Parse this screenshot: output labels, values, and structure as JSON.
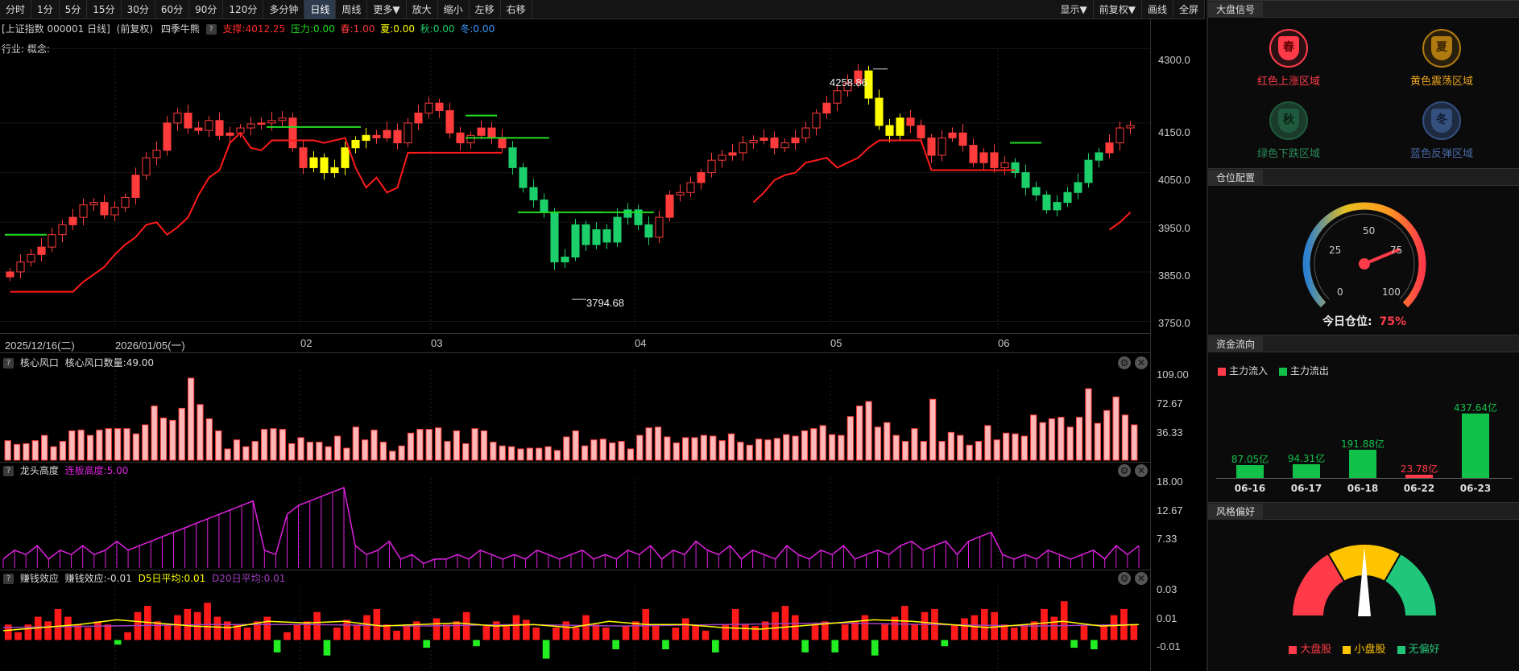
{
  "toolbar": {
    "periods": [
      "分时",
      "1分",
      "5分",
      "15分",
      "30分",
      "60分",
      "90分",
      "120分",
      "多分钟",
      "日线",
      "周线",
      "更多▼",
      "放大",
      "缩小",
      "左移",
      "右移"
    ],
    "active": "日线",
    "right_buttons": [
      "显示▼",
      "前复权▼",
      "画线",
      "全屏"
    ]
  },
  "info": {
    "security": "[上证指数 000001 日线]",
    "adjust": "(前复权)",
    "indicator": "四季牛熊",
    "support": "支撑:4012.25",
    "pressure": "压力:0.00",
    "spring": "春:1.00",
    "summer": "夏:0.00",
    "autumn": "秋:0.00",
    "winter": "冬:0.00",
    "industry": "行业: 概念:"
  },
  "colors": {
    "up": "#ff3b3b",
    "down": "#1ccf6a",
    "summer": "#ffff00",
    "support_line": "#ff1a1a",
    "pressure_line": "#22dd22",
    "magenta": "#e020e0",
    "purple": "#a040c0"
  },
  "main_chart": {
    "y_ticks": [
      "4300.0",
      "4150.0",
      "4050.0",
      "3950.0",
      "3850.0",
      "3750.0"
    ],
    "high_label": "4258.86",
    "low_label": "3794.68",
    "dates": [
      "2025/12/16(二)",
      "2026/01/05(一)",
      "02",
      "03",
      "04",
      "05",
      "06"
    ]
  },
  "sub1": {
    "title": "核心风口",
    "value_label": "核心风口数量:49.00",
    "y_ticks": [
      "109.00",
      "72.67",
      "36.33"
    ]
  },
  "sub2": {
    "title": "龙头高度",
    "value_label": "连板高度:5.00",
    "y_ticks": [
      "18.00",
      "12.67",
      "7.33"
    ]
  },
  "sub3": {
    "title": "赚钱效应",
    "value_label": "赚钱效应:-0.01",
    "d5": "D5日平均:0.01",
    "d20": "D20日平均:0.01",
    "y_ticks": [
      "0.03",
      "0.01",
      "-0.01"
    ]
  },
  "right": {
    "signal_title": "大盘信号",
    "seasons": [
      {
        "char": "春",
        "label": "红色上涨区域",
        "color": "#ff3b4a"
      },
      {
        "char": "夏",
        "label": "黄色震荡区域",
        "color": "#e8a21a"
      },
      {
        "char": "秋",
        "label": "绿色下跌区域",
        "color": "#2a8a5a"
      },
      {
        "char": "冬",
        "label": "蓝色反弹区域",
        "color": "#4a6aa8"
      }
    ],
    "position_title": "仓位配置",
    "gauge_ticks": [
      "0",
      "25",
      "50",
      "75",
      "100"
    ],
    "position_label": "今日仓位:",
    "position_value": "75%",
    "position_fraction": 0.75,
    "flow_title": "资金流向",
    "flow_in": "主力流入",
    "flow_out": "主力流出",
    "flows": [
      {
        "date": "06-16",
        "value": "87.05亿",
        "amount": 87.05,
        "dir": "out"
      },
      {
        "date": "06-17",
        "value": "94.31亿",
        "amount": 94.31,
        "dir": "out"
      },
      {
        "date": "06-18",
        "value": "191.88亿",
        "amount": 191.88,
        "dir": "out"
      },
      {
        "date": "06-22",
        "value": "23.78亿",
        "amount": 23.78,
        "dir": "in"
      },
      {
        "date": "06-23",
        "value": "437.64亿",
        "amount": 437.64,
        "dir": "out"
      }
    ],
    "style_title": "风格偏好",
    "style_legend": [
      "大盘股",
      "小盘股",
      "无偏好"
    ]
  },
  "chart_data": [
    {
      "type": "candlestick",
      "title": "上证指数 000001 日线",
      "ylim": [
        3730,
        4320
      ],
      "y_ticks": [
        4300,
        4150,
        4050,
        3950,
        3850,
        3750
      ],
      "high": 4258.86,
      "low": 3794.68,
      "close_path": [
        3850,
        3870,
        3885,
        3900,
        3925,
        3945,
        3960,
        3985,
        3990,
        3965,
        3980,
        4000,
        4045,
        4080,
        4095,
        4150,
        4170,
        4140,
        4135,
        4155,
        4125,
        4130,
        4140,
        4148,
        4150,
        4155,
        4160,
        4100,
        4060,
        4080,
        4050,
        4060,
        4100,
        4115,
        4125,
        4120,
        4135,
        4110,
        4150,
        4170,
        4190,
        4175,
        4130,
        4110,
        4125,
        4140,
        4120,
        4100,
        4060,
        4020,
        3995,
        3970,
        3870,
        3880,
        3945,
        3905,
        3935,
        3910,
        3960,
        3975,
        3945,
        3920,
        3960,
        4005,
        4010,
        4030,
        4050,
        4075,
        4085,
        4090,
        4110,
        4115,
        4120,
        4100,
        4110,
        4120,
        4140,
        4170,
        4190,
        4215,
        4230,
        4255,
        4200,
        4145,
        4125,
        4160,
        4145,
        4120,
        4085,
        4120,
        4130,
        4105,
        4070,
        4090,
        4060,
        4070,
        4050,
        4020,
        4005,
        3975,
        3990,
        4010,
        4030,
        4075,
        4090,
        4110,
        4140,
        4145
      ],
      "support_line": "red stepped line, last value 4012.25",
      "pressure_line": "green segments"
    },
    {
      "type": "bar",
      "title": "核心风口",
      "ylim": [
        0,
        109
      ],
      "y_ticks": [
        109.0,
        72.67,
        36.33
      ],
      "values": [
        26,
        21,
        22,
        26,
        33,
        18,
        25,
        39,
        40,
        33,
        40,
        42,
        42,
        42,
        35,
        47,
        72,
        56,
        53,
        69,
        109,
        74,
        55,
        39,
        15,
        27,
        18,
        25,
        41,
        42,
        41,
        22,
        30,
        24,
        24,
        18,
        32,
        16,
        44,
        27,
        40,
        24,
        12,
        19,
        36,
        41,
        41,
        43,
        25,
        39,
        22,
        42,
        39,
        24,
        19,
        18,
        15,
        16,
        16,
        18,
        13,
        31,
        39,
        19,
        27,
        28,
        23,
        25,
        15,
        33,
        43,
        44,
        31,
        23,
        30,
        30,
        33,
        32,
        26,
        35,
        24,
        20,
        28,
        27,
        29,
        34,
        32,
        39,
        42,
        46,
        34,
        33,
        58,
        72,
        78,
        44,
        50,
        33,
        25,
        42,
        25,
        81,
        25,
        37,
        33,
        20,
        25,
        46,
        27,
        36,
        35,
        32,
        60,
        50,
        55,
        57,
        44,
        57,
        95,
        49,
        66,
        84,
        60,
        47
      ]
    },
    {
      "type": "line",
      "title": "龙头高度",
      "ylim": [
        0,
        18
      ],
      "y_ticks": [
        18.0,
        12.67,
        7.33
      ],
      "series": [
        {
          "name": "连板高度",
          "values": [
            2,
            4,
            3,
            5,
            2,
            4,
            3,
            5,
            3,
            4,
            6,
            4,
            5,
            6,
            7,
            8,
            9,
            10,
            11,
            12,
            13,
            14,
            15,
            4,
            3,
            12,
            14,
            15,
            16,
            17,
            18,
            5,
            3,
            4,
            6,
            2,
            3,
            1,
            2,
            2,
            3,
            2,
            4,
            3,
            2,
            3,
            2,
            4,
            3,
            2,
            3,
            4,
            2,
            3,
            2,
            4,
            3,
            5,
            2,
            4,
            3,
            6,
            4,
            3,
            5,
            2,
            4,
            3,
            2,
            5,
            3,
            2,
            4,
            3,
            5,
            2,
            3,
            4,
            3,
            5,
            6,
            4,
            5,
            6,
            3,
            6,
            7,
            8,
            3,
            2,
            3,
            2,
            4,
            3,
            2,
            3,
            4,
            2,
            5,
            3,
            5
          ]
        }
      ]
    },
    {
      "type": "bar",
      "title": "赚钱效应",
      "ylim": [
        -0.02,
        0.035
      ],
      "y_ticks": [
        0.03,
        0.01,
        -0.01
      ],
      "series": [
        {
          "name": "赚钱效应",
          "values": [
            0.01,
            0.005,
            0.01,
            0.015,
            0.012,
            0.02,
            0.015,
            0.01,
            0.008,
            0.012,
            0.01,
            -0.003,
            0.005,
            0.018,
            0.022,
            0.012,
            0.01,
            0.016,
            0.02,
            0.018,
            0.024,
            0.015,
            0.012,
            0.01,
            0.008,
            0.012,
            0.015,
            -0.008,
            0.005,
            0.01,
            0.012,
            0.018,
            -0.01,
            0.008,
            0.013,
            0.01,
            0.016,
            0.02,
            0.01,
            0.006,
            0.01,
            0.012,
            -0.005,
            0.014,
            0.01,
            0.012,
            0.018,
            -0.004,
            0.009,
            0.012,
            0.01,
            0.016,
            0.013,
            0.008,
            -0.012,
            0.008,
            0.012,
            0.008,
            0.016,
            0.01,
            0.008,
            -0.006,
            0.009,
            0.012,
            0.02,
            0.01,
            -0.006,
            0.008,
            0.014,
            0.01,
            0.006,
            -0.008,
            0.01,
            0.02,
            0.01,
            0.009,
            0.012,
            0.018,
            0.022,
            0.016,
            -0.008,
            0.01,
            0.012,
            -0.008,
            0.01,
            0.012,
            0.016,
            -0.01,
            0.01,
            0.015,
            0.022,
            0.01,
            0.018,
            0.02,
            -0.004,
            0.01,
            0.014,
            0.016,
            0.02,
            0.018,
            0.01,
            0.008,
            0.01,
            0.012,
            0.02,
            0.015,
            0.025,
            -0.005,
            0.01,
            -0.006,
            0.01,
            0.016,
            0.02,
            0.01
          ]
        },
        {
          "name": "D5日平均",
          "values": [
            0.006,
            0.008,
            0.01,
            0.013,
            0.011,
            0.009,
            0.008,
            0.012,
            0.011,
            0.012,
            0.009,
            0.01,
            0.011,
            0.009,
            0.01,
            0.008,
            0.012,
            0.01,
            0.01,
            0.008,
            0.007,
            0.009,
            0.011,
            0.013,
            0.012,
            0.01,
            0.008,
            0.01,
            0.012,
            0.009,
            0.01
          ]
        },
        {
          "name": "D20日平均",
          "values": [
            0.008,
            0.009,
            0.01,
            0.01,
            0.009,
            0.01,
            0.009,
            0.01,
            0.011,
            0.01,
            0.009,
            0.01
          ]
        }
      ]
    },
    {
      "type": "bar",
      "title": "资金流向",
      "categories": [
        "06-16",
        "06-17",
        "06-18",
        "06-22",
        "06-23"
      ],
      "values": [
        87.05,
        94.31,
        191.88,
        23.78,
        437.64
      ],
      "series": [
        {
          "name": "主力流出"
        },
        {
          "name": "主力流入"
        }
      ]
    }
  ]
}
